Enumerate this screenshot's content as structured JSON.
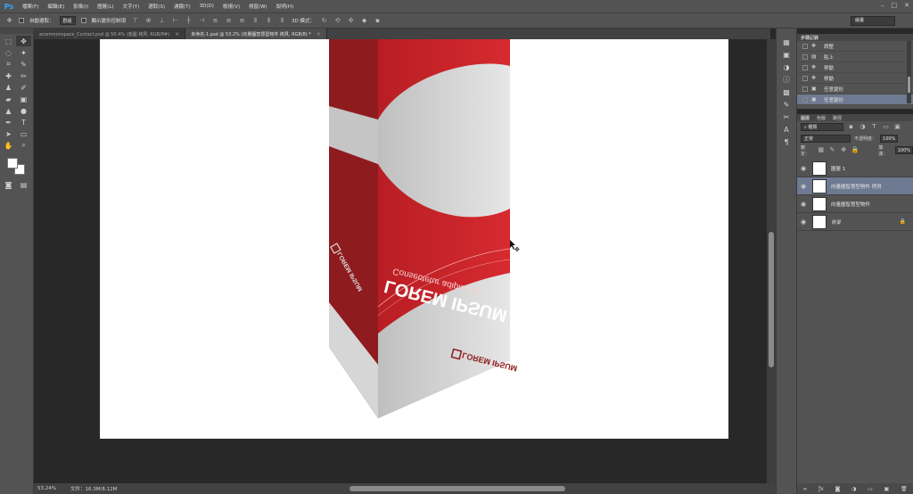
{
  "app": {
    "logo": "Ps"
  },
  "menubar": {
    "items": [
      "檔案(F)",
      "編輯(E)",
      "影像(I)",
      "圖層(L)",
      "文字(Y)",
      "選取(S)",
      "濾鏡(T)",
      "3D(D)",
      "檢視(V)",
      "視窗(W)",
      "說明(H)"
    ],
    "window_controls": [
      "–",
      "□",
      "✕"
    ]
  },
  "options": {
    "auto_select_label": "自動選取：",
    "auto_select_value": "群組",
    "transform_label": "顯示變形控制項",
    "mode_label": "3D 模式：",
    "workspace": "繪畫"
  },
  "tabs": [
    {
      "title": "acommonspace_Contact.psd @ 50.4% (底圖 拷貝, RGB/8#)",
      "close": "×"
    },
    {
      "title": "未命名-1.psd @ 53.2% (向量圖智慧型物件 拷貝, RGB/8) *",
      "close": "×"
    }
  ],
  "status": {
    "zoom": "53.24%",
    "doc_size": "文件：16.3M/8.12M"
  },
  "history": {
    "tabs": [
      "步驟記錄"
    ],
    "rows": [
      {
        "label": "調整",
        "icon": "move-icon"
      },
      {
        "label": "貼上",
        "icon": "paste-icon"
      },
      {
        "label": "移動",
        "icon": "move-icon"
      },
      {
        "label": "移動",
        "icon": "move-icon"
      },
      {
        "label": "任意變形",
        "icon": "transform-icon"
      },
      {
        "label": "任意變形",
        "icon": "transform-icon"
      }
    ]
  },
  "layers": {
    "tabs": [
      "圖層",
      "色版",
      "路徑"
    ],
    "filter_kind": "種類",
    "blend_mode": "正常",
    "opacity_label": "不透明度：",
    "opacity_value": "100%",
    "lock_label": "鎖定：",
    "fill_label": "填滿：",
    "fill_value": "100%",
    "rows": [
      {
        "name": "圖層 1"
      },
      {
        "name": "向量圖智慧型物件 拷貝"
      },
      {
        "name": "向量圖智慧型物件"
      },
      {
        "name": "背景"
      }
    ]
  },
  "artwork": {
    "brand": "LOREM IPSUM",
    "tagline": "Consectetur adipiscing",
    "logo_text": "LOREM IPSUM",
    "colors": {
      "red": "#c8242a",
      "dark_red": "#8f1a1d",
      "light": "#d8d8d8"
    }
  }
}
